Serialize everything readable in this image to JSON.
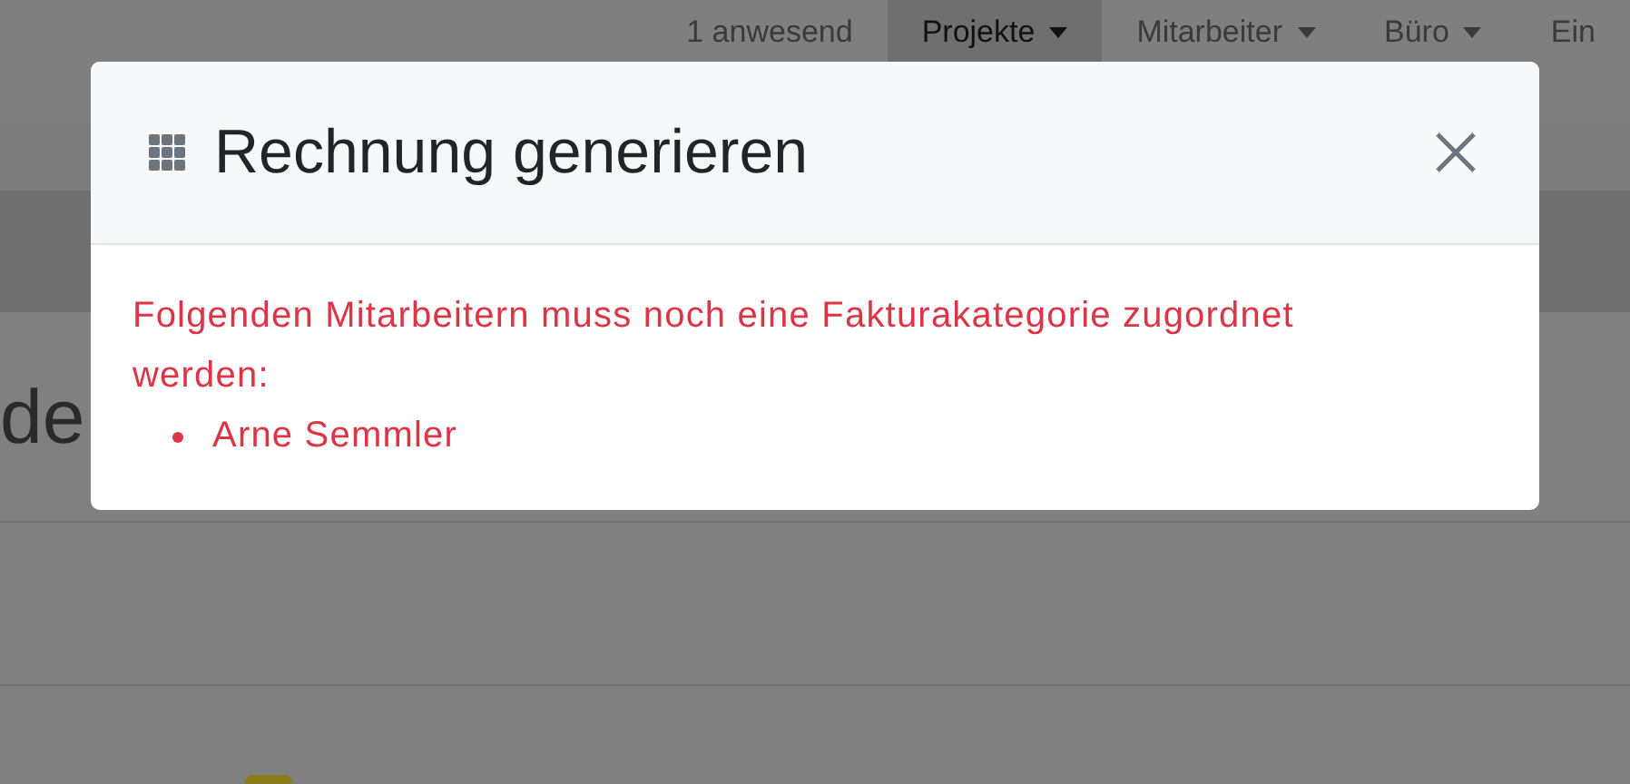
{
  "navbar": {
    "items": [
      {
        "label": "1 anwesend",
        "selected": false,
        "has_menu": false
      },
      {
        "label": "Projekte",
        "selected": true,
        "has_menu": true
      },
      {
        "label": "Mitarbeiter",
        "selected": false,
        "has_menu": true
      },
      {
        "label": "Büro",
        "selected": false,
        "has_menu": true
      },
      {
        "label": "Ein",
        "selected": false,
        "has_menu": false
      }
    ]
  },
  "page": {
    "heading": "de"
  },
  "dialog": {
    "title": "Rechnung generieren",
    "message": "Folgenden Mitarbeitern muss noch eine Fakturakategorie zugordnet werden:",
    "items": [
      "Arne Semmler"
    ]
  }
}
